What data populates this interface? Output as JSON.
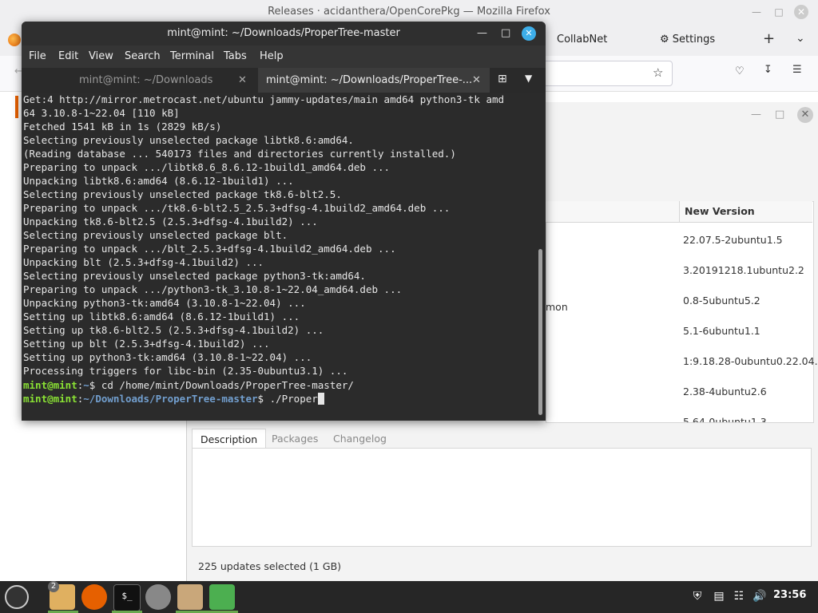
{
  "firefox": {
    "title": "Releases · acidanthera/OpenCorePkg — Mozilla Firefox",
    "tabs": [
      "CollabNet",
      "Settings"
    ]
  },
  "update_manager": {
    "header_new_version": "New Version",
    "name_partial": "mon",
    "versions": [
      "22.07.5-2ubuntu1.5",
      "3.20191218.1ubuntu2.2",
      "0.8-5ubuntu5.2",
      "5.1-6ubuntu1.1",
      "1:9.18.28-0ubuntu0.22.04.",
      "2.38-4ubuntu2.6",
      "5.64-0ubuntu1.3"
    ],
    "tabs": [
      "Description",
      "Packages",
      "Changelog"
    ],
    "status": "225 updates selected (1 GB)"
  },
  "terminal": {
    "title": "mint@mint: ~/Downloads/ProperTree-master",
    "menu": [
      "File",
      "Edit",
      "View",
      "Search",
      "Terminal",
      "Tabs",
      "Help"
    ],
    "tabs": [
      "mint@mint: ~/Downloads",
      "mint@mint: ~/Downloads/ProperTree-..."
    ],
    "lines": [
      "Get:4 http://mirror.metrocast.net/ubuntu jammy-updates/main amd64 python3-tk amd",
      "64 3.10.8-1~22.04 [110 kB]",
      "Fetched 1541 kB in 1s (2829 kB/s)",
      "Selecting previously unselected package libtk8.6:amd64.",
      "(Reading database ... 540173 files and directories currently installed.)",
      "Preparing to unpack .../libtk8.6_8.6.12-1build1_amd64.deb ...",
      "Unpacking libtk8.6:amd64 (8.6.12-1build1) ...",
      "Selecting previously unselected package tk8.6-blt2.5.",
      "Preparing to unpack .../tk8.6-blt2.5_2.5.3+dfsg-4.1build2_amd64.deb ...",
      "Unpacking tk8.6-blt2.5 (2.5.3+dfsg-4.1build2) ...",
      "Selecting previously unselected package blt.",
      "Preparing to unpack .../blt_2.5.3+dfsg-4.1build2_amd64.deb ...",
      "Unpacking blt (2.5.3+dfsg-4.1build2) ...",
      "Selecting previously unselected package python3-tk:amd64.",
      "Preparing to unpack .../python3-tk_3.10.8-1~22.04_amd64.deb ...",
      "Unpacking python3-tk:amd64 (3.10.8-1~22.04) ...",
      "Setting up libtk8.6:amd64 (8.6.12-1build1) ...",
      "Setting up tk8.6-blt2.5 (2.5.3+dfsg-4.1build2) ...",
      "Setting up blt (2.5.3+dfsg-4.1build2) ...",
      "Setting up python3-tk:amd64 (3.10.8-1~22.04) ...",
      "Processing triggers for libc-bin (2.35-0ubuntu3.1) ..."
    ],
    "prompt1": {
      "user": "mint@mint",
      "sep": ":",
      "path": "~",
      "cmd": "$ cd /home/mint/Downloads/ProperTree-master/"
    },
    "prompt2": {
      "user": "mint@mint",
      "sep": ":",
      "path": "~/Downloads/ProperTree-master",
      "cmd": "$ ./Proper"
    }
  },
  "taskbar": {
    "badge": "2",
    "clock": "23:56",
    "terminal_icon_text": "$_"
  },
  "colors": {
    "prompt_user": "#8ae234",
    "prompt_path": "#729fcf",
    "accent_green": "#6aa84f",
    "close_button_blue": "#3daee9"
  },
  "icons": [
    "firefox-icon",
    "settings-gear-icon",
    "plus-icon",
    "chevron-down-icon",
    "pocket-icon",
    "download-icon",
    "menu-icon",
    "star-icon",
    "mint-menu-icon",
    "files-icon",
    "terminal-icon",
    "update-manager-icon",
    "shield-icon",
    "volume-icon",
    "network-icon"
  ]
}
